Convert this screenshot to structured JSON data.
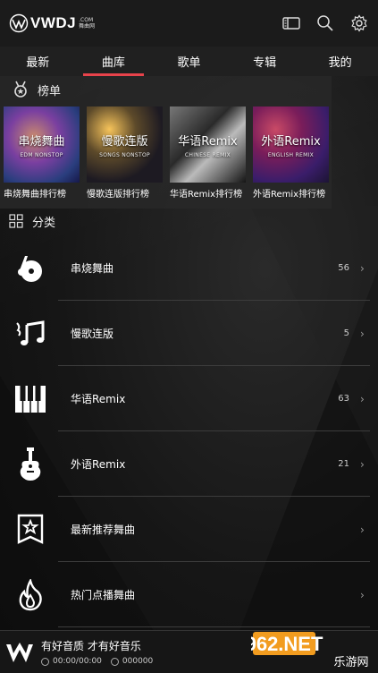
{
  "header": {
    "logo_text": "VWDJ",
    "logo_sub_1": ".COM",
    "logo_sub_2": "舞曲网"
  },
  "tabs": [
    {
      "label": "最新",
      "active": false
    },
    {
      "label": "曲库",
      "active": true
    },
    {
      "label": "歌单",
      "active": false
    },
    {
      "label": "专辑",
      "active": false
    },
    {
      "label": "我的",
      "active": false
    }
  ],
  "charts_section": {
    "title": "榜单",
    "items": [
      {
        "cover_title": "串烧舞曲",
        "cover_sub": "EDM NONSTOP",
        "label": "串烧舞曲排行榜"
      },
      {
        "cover_title": "慢歌连版",
        "cover_sub": "SONGS NONSTOP",
        "label": "慢歌连版排行榜"
      },
      {
        "cover_title": "华语Remix",
        "cover_sub": "CHINESE REMIX",
        "label": "华语Remix排行榜"
      },
      {
        "cover_title": "外语Remix",
        "cover_sub": "ENGLISH REMIX",
        "label": "外语Remix排行榜"
      }
    ]
  },
  "categories_section": {
    "title": "分类",
    "items": [
      {
        "name": "串烧舞曲",
        "count": "56",
        "icon": "music-disc-icon"
      },
      {
        "name": "慢歌连版",
        "count": "5",
        "icon": "music-note-icon"
      },
      {
        "name": "华语Remix",
        "count": "63",
        "icon": "piano-keys-icon"
      },
      {
        "name": "外语Remix",
        "count": "21",
        "icon": "guitar-icon"
      },
      {
        "name": "最新推荐舞曲",
        "count": "",
        "icon": "star-badge-icon"
      },
      {
        "name": "热门点播舞曲",
        "count": "",
        "icon": "flame-icon"
      }
    ],
    "chevron": "›"
  },
  "player": {
    "title": "有好音质 才有好音乐",
    "time": "00:00/00:00",
    "plays": "000000"
  },
  "watermark": {
    "text": "962.NET",
    "sub": "乐游网"
  },
  "colors": {
    "accent": "#e8434b",
    "background": "#141414",
    "watermark_orange": "#f29c1f"
  }
}
